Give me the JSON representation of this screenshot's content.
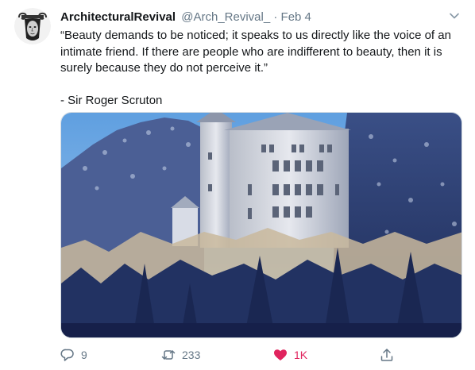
{
  "tweet": {
    "author_name": "ArchitecturalRevival",
    "handle": "@Arch_Revival_",
    "separator": "·",
    "date": "Feb 4",
    "text_quote": "“Beauty demands to be noticed; it speaks to us directly like the voice of an intimate friend. If there are people who are indifferent to beauty, then it is surely because they do not perceive it.”",
    "text_attribution": "- Sir Roger Scruton",
    "media_icon": "castle-photo"
  },
  "actions": {
    "reply": {
      "icon": "reply-icon",
      "count": "9"
    },
    "retweet": {
      "icon": "retweet-icon",
      "count": "233"
    },
    "like": {
      "icon": "heart-icon",
      "count": "1K",
      "active": true,
      "color": "#e0245e"
    },
    "share": {
      "icon": "share-icon"
    }
  },
  "colors": {
    "text": "#14171a",
    "secondary": "#657786",
    "like": "#e0245e"
  }
}
